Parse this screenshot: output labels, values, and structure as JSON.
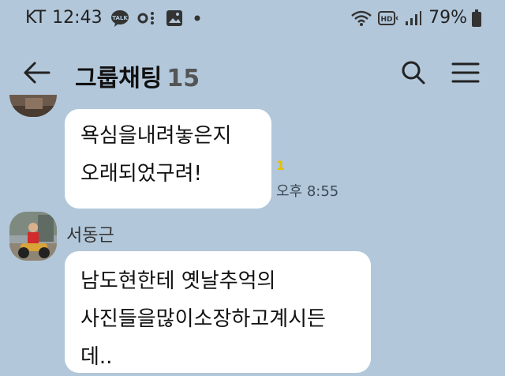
{
  "status_bar": {
    "carrier": "KT",
    "time": "12:43",
    "battery": "79%",
    "left_icons": [
      "talk-icon",
      "voicemail-icon",
      "image-icon",
      "dot-icon"
    ],
    "right_icons": [
      "wifi-icon",
      "hd-icon",
      "signal-icon",
      "battery-icon"
    ]
  },
  "header": {
    "title": "그룹채팅",
    "member_count": "15"
  },
  "messages": [
    {
      "lines": [
        "욕심을내려놓은지",
        "오래되었구려!"
      ],
      "unread": "1",
      "time": "오후 8:55"
    },
    {
      "sender": "서동근",
      "lines": [
        "남도현한테 옛날추억의",
        "사진들을많이소장하고계시든",
        "데.."
      ]
    }
  ],
  "colors": {
    "background": "#b2c7da",
    "bubble": "#ffffff",
    "unread": "#e4c100"
  }
}
